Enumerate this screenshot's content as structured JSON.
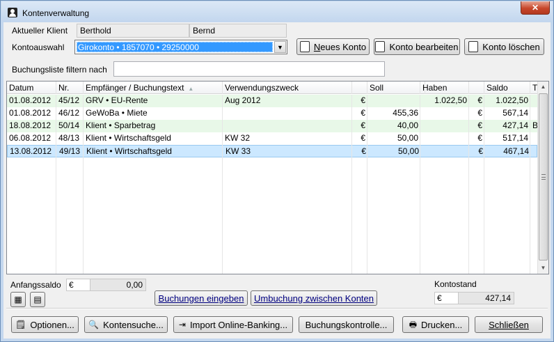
{
  "window": {
    "title": "Kontenverwaltung",
    "close_label": "✕"
  },
  "client": {
    "label": "Aktueller Klient",
    "first_name": "Berthold",
    "last_name": "Bernd"
  },
  "account": {
    "label": "Kontoauswahl",
    "selected": "Girokonto • 1857070 • 29250000"
  },
  "buttons": {
    "new_account_u": "N",
    "new_account_rest": "eues Konto",
    "edit_account": "Konto bearbeiten",
    "delete_account": "Konto löschen",
    "enter_bookings": "Buchungen eingeben",
    "transfer": "Umbuchung zwischen Konten",
    "options": "Optionen...",
    "account_search": "Kontensuche...",
    "import_banking": "Import Online-Banking...",
    "booking_control": "Buchungskontrolle...",
    "print": "Drucken...",
    "close": "Schließen"
  },
  "filter": {
    "label": "Buchungsliste filtern nach",
    "value": ""
  },
  "table": {
    "columns": [
      "Datum",
      "Nr.",
      "Empfänger / Buchungstext",
      "Verwendungszweck",
      "",
      "Soll",
      "",
      "Haben",
      "",
      "Saldo",
      "T"
    ],
    "rows": [
      {
        "date": "01.08.2012",
        "nr": "45/12",
        "payee": "GRV • EU-Rente",
        "purpose": "Aug 2012",
        "cur1": "€",
        "soll": "",
        "cur2": "",
        "haben": "1.022,50",
        "cur3": "€",
        "saldo": "1.022,50",
        "t": "",
        "style": "green"
      },
      {
        "date": "01.08.2012",
        "nr": "46/12",
        "payee": "GeWoBa • Miete",
        "purpose": "",
        "cur1": "€",
        "soll": "455,36",
        "cur2": "",
        "haben": "",
        "cur3": "€",
        "saldo": "567,14",
        "t": "",
        "style": "white"
      },
      {
        "date": "18.08.2012",
        "nr": "50/14",
        "payee": "Klient • Sparbetrag",
        "purpose": "",
        "cur1": "€",
        "soll": "40,00",
        "cur2": "",
        "haben": "",
        "cur3": "€",
        "saldo": "427,14",
        "t": "B",
        "style": "green"
      },
      {
        "date": "06.08.2012",
        "nr": "48/13",
        "payee": "Klient • Wirtschaftsgeld",
        "purpose": "KW 32",
        "cur1": "€",
        "soll": "50,00",
        "cur2": "",
        "haben": "",
        "cur3": "€",
        "saldo": "517,14",
        "t": "",
        "style": "white"
      },
      {
        "date": "13.08.2012",
        "nr": "49/13",
        "payee": "Klient • Wirtschaftsgeld",
        "purpose": "KW 33",
        "cur1": "€",
        "soll": "50,00",
        "cur2": "",
        "haben": "",
        "cur3": "€",
        "saldo": "467,14",
        "t": "",
        "style": "selected"
      }
    ]
  },
  "opening_balance": {
    "label": "Anfangssaldo",
    "currency": "€",
    "amount": "0,00"
  },
  "account_balance": {
    "label": "Kontostand",
    "currency": "€",
    "amount": "427,14"
  }
}
